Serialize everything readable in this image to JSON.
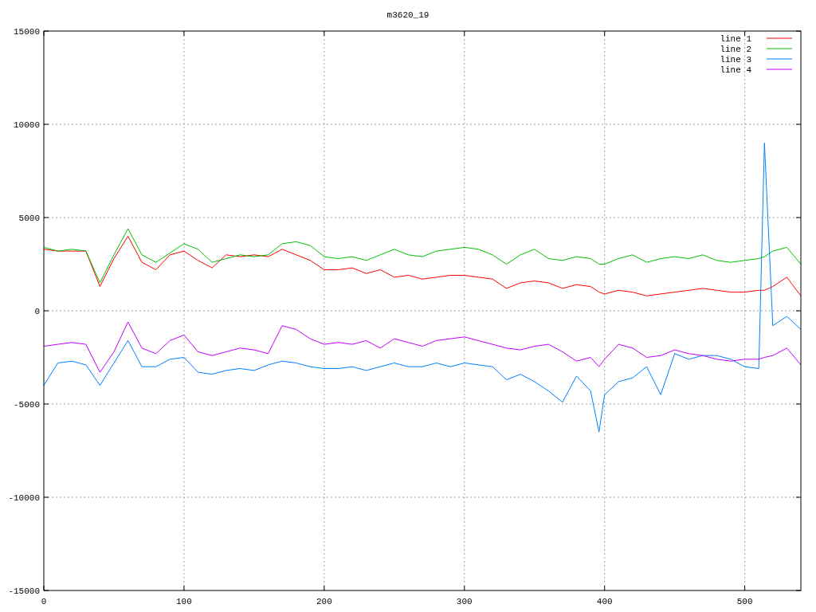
{
  "chart_data": {
    "type": "line",
    "title": "m3620_19",
    "x": [
      0,
      10,
      20,
      30,
      40,
      50,
      60,
      70,
      80,
      90,
      100,
      110,
      120,
      130,
      140,
      150,
      160,
      170,
      180,
      190,
      200,
      210,
      220,
      230,
      240,
      250,
      260,
      270,
      280,
      290,
      300,
      310,
      320,
      330,
      340,
      350,
      360,
      370,
      380,
      390,
      396,
      400,
      410,
      420,
      430,
      440,
      450,
      460,
      470,
      480,
      490,
      500,
      510,
      514,
      520,
      530,
      540
    ],
    "series": [
      {
        "name": "line 1",
        "color": "#ff0000",
        "values": [
          3300,
          3200,
          3200,
          3200,
          1300,
          2800,
          4000,
          2600,
          2200,
          3000,
          3200,
          2700,
          2300,
          3000,
          2900,
          3000,
          2900,
          3300,
          3000,
          2700,
          2200,
          2200,
          2300,
          2000,
          2200,
          1800,
          1900,
          1700,
          1800,
          1900,
          1900,
          1800,
          1700,
          1200,
          1500,
          1600,
          1500,
          1200,
          1400,
          1300,
          1000,
          900,
          1100,
          1000,
          800,
          900,
          1000,
          1100,
          1200,
          1100,
          1000,
          1000,
          1100,
          1100,
          1300,
          1800,
          800
        ]
      },
      {
        "name": "line 2",
        "color": "#00c000",
        "values": [
          3400,
          3200,
          3300,
          3200,
          1500,
          3000,
          4400,
          3000,
          2600,
          3100,
          3600,
          3300,
          2600,
          2800,
          3000,
          2900,
          3000,
          3600,
          3700,
          3500,
          2900,
          2800,
          2900,
          2700,
          3000,
          3300,
          3000,
          2900,
          3200,
          3300,
          3400,
          3300,
          3000,
          2500,
          3000,
          3300,
          2800,
          2700,
          2900,
          2800,
          2500,
          2500,
          2800,
          3000,
          2600,
          2800,
          2900,
          2800,
          3000,
          2700,
          2600,
          2700,
          2800,
          2900,
          3200,
          3400,
          2500
        ]
      },
      {
        "name": "line 3",
        "color": "#0080ff",
        "values": [
          -4000,
          -2800,
          -2700,
          -2900,
          -4000,
          -2800,
          -1600,
          -3000,
          -3000,
          -2600,
          -2500,
          -3300,
          -3400,
          -3200,
          -3100,
          -3200,
          -2900,
          -2700,
          -2800,
          -3000,
          -3100,
          -3100,
          -3000,
          -3200,
          -3000,
          -2800,
          -3000,
          -3000,
          -2800,
          -3000,
          -2800,
          -2900,
          -3000,
          -3700,
          -3400,
          -3800,
          -4300,
          -4900,
          -3500,
          -4300,
          -6500,
          -4500,
          -3800,
          -3600,
          -3000,
          -4500,
          -2300,
          -2600,
          -2400,
          -2400,
          -2600,
          -3000,
          -3100,
          9000,
          -800,
          -300,
          -1000
        ]
      },
      {
        "name": "line 4",
        "color": "#c000ff",
        "values": [
          -1900,
          -1800,
          -1700,
          -1800,
          -3300,
          -2200,
          -600,
          -2000,
          -2300,
          -1600,
          -1300,
          -2200,
          -2400,
          -2200,
          -2000,
          -2100,
          -2300,
          -800,
          -1000,
          -1500,
          -1800,
          -1700,
          -1800,
          -1600,
          -2000,
          -1500,
          -1700,
          -1900,
          -1600,
          -1500,
          -1400,
          -1600,
          -1800,
          -2000,
          -2100,
          -1900,
          -1800,
          -2200,
          -2700,
          -2500,
          -3000,
          -2600,
          -1800,
          -2000,
          -2500,
          -2400,
          -2100,
          -2300,
          -2400,
          -2600,
          -2700,
          -2600,
          -2600,
          -2500,
          -2400,
          -2000,
          -2900
        ]
      }
    ],
    "grid": true,
    "legend": true,
    "xlim": [
      0,
      540
    ],
    "ylim": [
      -15000,
      15000
    ],
    "xticks": [
      0,
      100,
      200,
      300,
      400,
      500
    ],
    "yticks": [
      -15000,
      -10000,
      -5000,
      0,
      5000,
      10000,
      15000
    ]
  }
}
